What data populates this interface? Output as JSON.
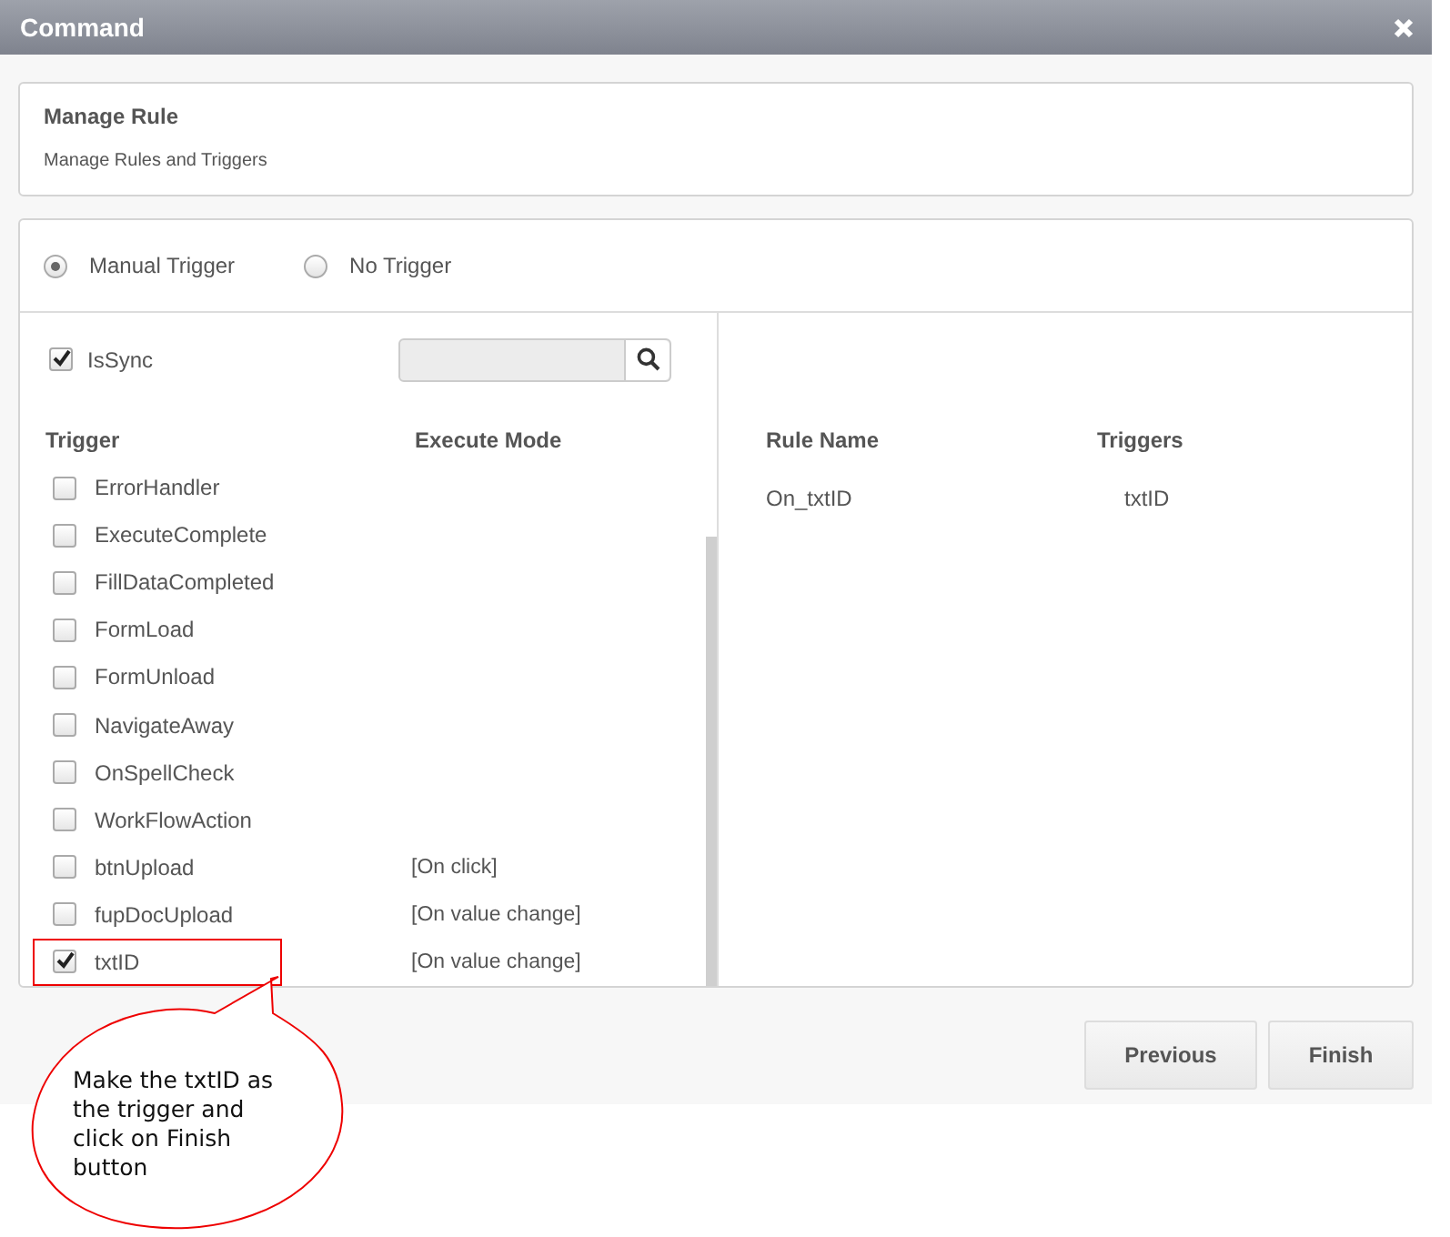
{
  "window": {
    "title": "Command"
  },
  "header": {
    "title": "Manage Rule",
    "subtitle": "Manage Rules and Triggers"
  },
  "trigger_modes": [
    {
      "label": "Manual Trigger",
      "selected": true
    },
    {
      "label": "No Trigger",
      "selected": false
    }
  ],
  "is_sync": {
    "label": "IsSync",
    "checked": true
  },
  "trigger_table": {
    "columns": [
      "Trigger",
      "Execute Mode"
    ],
    "rows": [
      {
        "trigger": "ErrorHandler",
        "checked": false,
        "highlighted": false
      },
      {
        "trigger": "ExecuteComplete",
        "checked": false,
        "highlighted": false
      },
      {
        "trigger": "FillDataCompleted",
        "checked": false,
        "highlighted": false
      },
      {
        "trigger": "FormLoad",
        "checked": false,
        "highlighted": false
      },
      {
        "trigger": "FormUnload",
        "checked": false,
        "highlighted": false
      },
      {
        "trigger": "NavigateAway",
        "checked": false,
        "highlighted": false
      },
      {
        "trigger": "OnSpellCheck",
        "checked": false,
        "highlighted": false
      },
      {
        "trigger": "WorkFlowAction",
        "checked": false,
        "highlighted": false
      },
      {
        "trigger": "btnUpload",
        "checked": false,
        "highlighted": false,
        "execute_mode": "[On click]"
      },
      {
        "trigger": "fupDocUpload",
        "checked": false,
        "highlighted": false,
        "execute_mode": "[On value change]"
      },
      {
        "trigger": "txtID",
        "checked": true,
        "highlighted": true,
        "execute_mode": "[On value change]"
      }
    ]
  },
  "rules_table": {
    "columns": [
      "Rule Name",
      "Triggers"
    ],
    "rows": [
      {
        "rule_name": "On_txtID",
        "triggers": "txtID"
      }
    ]
  },
  "buttons": [
    "Previous",
    "Finish"
  ],
  "annotation": {
    "text": "Make the txtID as the trigger and click on Finish button"
  }
}
